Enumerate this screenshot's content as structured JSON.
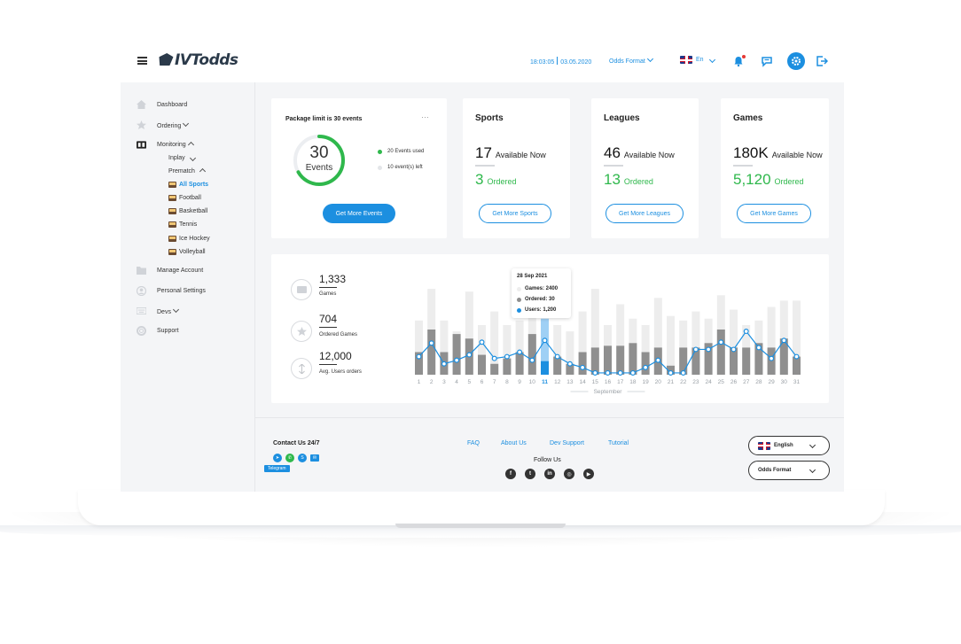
{
  "header": {
    "logo": "IVTodds",
    "time": "18:03:05",
    "date": "03.05.2020",
    "odds_format": "Odds Format",
    "language": "En"
  },
  "sidebar": {
    "items": [
      {
        "label": "Dashboard",
        "icon": "home-icon"
      },
      {
        "label": "Ordering",
        "icon": "star-icon"
      },
      {
        "label": "Monitoring",
        "icon": "scoreboard-icon"
      },
      {
        "label": "Manage Account",
        "icon": "folder-icon"
      },
      {
        "label": "Personal Settings",
        "icon": "user-icon"
      },
      {
        "label": "Devs",
        "icon": "keyboard-icon"
      },
      {
        "label": "Support",
        "icon": "lifebuoy-icon"
      }
    ],
    "monitoring_sub": {
      "inplay": "Inplay",
      "prematch": "Prematch"
    },
    "sports": [
      "All Sports",
      "Football",
      "Basketball",
      "Tennis",
      "Ice Hockey",
      "Volleyball"
    ]
  },
  "package": {
    "title": "Package limit is 30 events",
    "menu": "···",
    "number": "30",
    "unit": "Events",
    "used": "20 Events used",
    "left": "10 event(s) left",
    "used_fraction": 0.667,
    "button": "Get More Events"
  },
  "stats_cards": [
    {
      "title": "Sports",
      "available": "17",
      "available_label": "Available Now",
      "ordered": "3",
      "ordered_label": "Ordered",
      "button": "Get More Sports"
    },
    {
      "title": "Leagues",
      "available": "46",
      "available_label": "Available Now",
      "ordered": "13",
      "ordered_label": "Ordered",
      "button": "Get More Leagues"
    },
    {
      "title": "Games",
      "available": "180K",
      "available_label": "Available Now",
      "ordered": "5,120",
      "ordered_label": "Ordered",
      "button": "Get More Games"
    }
  ],
  "summary": [
    {
      "value": "1,333",
      "label": "Games",
      "icon": "monitor-icon"
    },
    {
      "value": "704",
      "label": "Ordered Games",
      "icon": "star-icon"
    },
    {
      "value": "12,000",
      "label": "Avg. Users orders",
      "icon": "sort-icon"
    }
  ],
  "tooltip": {
    "date": "28 Sep 2021",
    "games": "Games: 2400",
    "ordered": "Ordered: 30",
    "users": "Users: 1,200"
  },
  "chart_data": {
    "type": "bar",
    "xlabel": "September",
    "categories": [
      "1",
      "2",
      "3",
      "4",
      "5",
      "6",
      "7",
      "8",
      "9",
      "10",
      "11",
      "12",
      "13",
      "14",
      "15",
      "16",
      "17",
      "18",
      "19",
      "20",
      "21",
      "22",
      "23",
      "24",
      "25",
      "26",
      "27",
      "28",
      "29",
      "30",
      "31"
    ],
    "highlight_index": 10,
    "ylim": [
      0,
      100
    ],
    "series": [
      {
        "name": "Games",
        "values": [
          60,
          95,
          60,
          48,
          92,
          55,
          70,
          55,
          60,
          88,
          62,
          55,
          48,
          70,
          95,
          55,
          78,
          62,
          55,
          85,
          65,
          60,
          70,
          62,
          88,
          72,
          55,
          60,
          75,
          82,
          82
        ]
      },
      {
        "name": "Ordered",
        "values": [
          25,
          50,
          25,
          45,
          40,
          22,
          12,
          18,
          25,
          45,
          15,
          20,
          12,
          25,
          30,
          32,
          32,
          35,
          25,
          30,
          10,
          30,
          30,
          35,
          50,
          30,
          30,
          35,
          30,
          40,
          20
        ]
      },
      {
        "name": "Users",
        "values": [
          20,
          35,
          12,
          16,
          22,
          36,
          18,
          20,
          25,
          16,
          38,
          20,
          12,
          8,
          2,
          2,
          2,
          2,
          8,
          16,
          2,
          2,
          28,
          28,
          36,
          28,
          48,
          30,
          18,
          38,
          20
        ]
      }
    ]
  },
  "footer": {
    "contact_title": "Contact Us 24/7",
    "telegram_tag": "Telegram",
    "links": [
      "FAQ",
      "About Us",
      "Dev Support",
      "Tutorial"
    ],
    "follow": "Follow Us",
    "language_select": "English",
    "odds_select": "Odds Format"
  },
  "colors": {
    "accent": "#1c8fe0",
    "green": "#2fb84c",
    "bar_dark": "#8f8f8f",
    "bar_light": "#ededed"
  }
}
